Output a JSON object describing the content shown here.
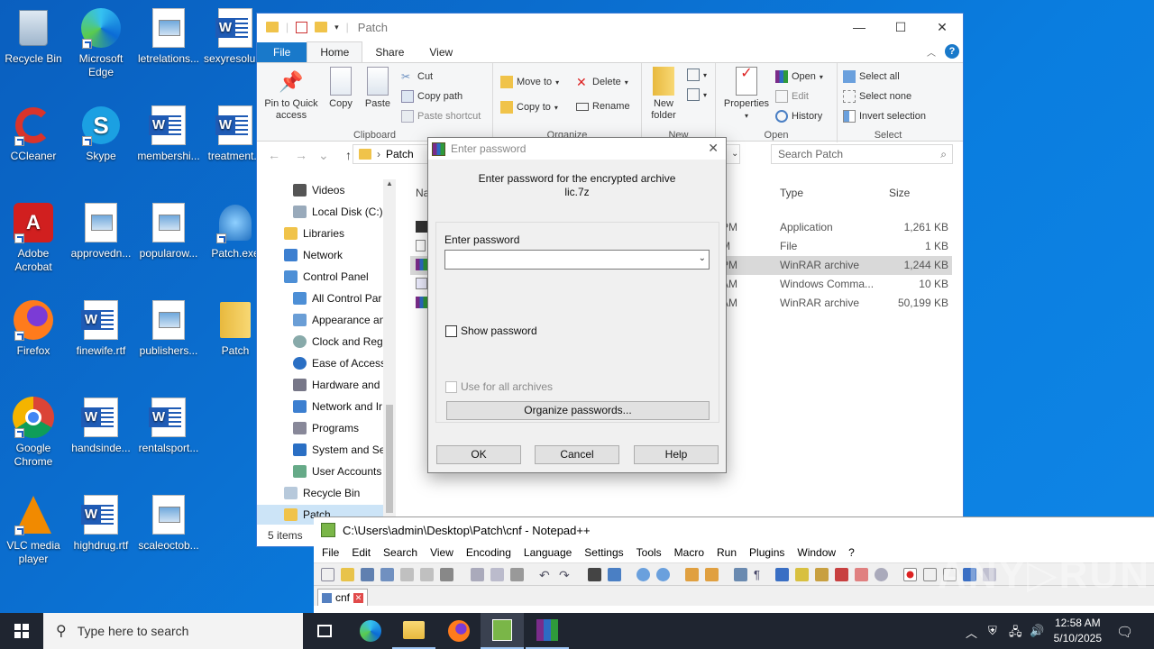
{
  "desktop": {
    "icons": [
      {
        "label": "Recycle Bin"
      },
      {
        "label": "Microsoft Edge"
      },
      {
        "label": "letrelations..."
      },
      {
        "label": "sexyresolut..."
      },
      {
        "label": "CCleaner"
      },
      {
        "label": "Skype"
      },
      {
        "label": "membershi..."
      },
      {
        "label": "treatment..."
      },
      {
        "label": "Adobe Acrobat"
      },
      {
        "label": "approvedn..."
      },
      {
        "label": "popularow..."
      },
      {
        "label": "Patch.exe"
      },
      {
        "label": "Firefox"
      },
      {
        "label": "finewife.rtf"
      },
      {
        "label": "publishers..."
      },
      {
        "label": "Patch"
      },
      {
        "label": "Google Chrome"
      },
      {
        "label": "handsinde..."
      },
      {
        "label": "rentalsport..."
      },
      {
        "label": "VLC media player"
      },
      {
        "label": "highdrug.rtf"
      },
      {
        "label": "scaleoctob..."
      }
    ]
  },
  "explorer": {
    "title": "Patch",
    "tabs": {
      "file": "File",
      "home": "Home",
      "share": "Share",
      "view": "View"
    },
    "ribbon": {
      "clipboard": {
        "group": "Clipboard",
        "pin": "Pin to Quick access",
        "copy": "Copy",
        "paste": "Paste",
        "cut": "Cut",
        "copy_path": "Copy path",
        "paste_shortcut": "Paste shortcut"
      },
      "organize": {
        "group": "Organize",
        "move_to": "Move to",
        "copy_to": "Copy to",
        "delete": "Delete",
        "rename": "Rename"
      },
      "new": {
        "group": "New",
        "new_folder": "New folder"
      },
      "open": {
        "group": "Open",
        "properties": "Properties",
        "open": "Open",
        "edit": "Edit",
        "history": "History"
      },
      "select": {
        "group": "Select",
        "select_all": "Select all",
        "select_none": "Select none",
        "invert": "Invert selection"
      }
    },
    "address": {
      "path": "Patch",
      "search_placeholder": "Search Patch"
    },
    "nav": [
      {
        "label": "Videos"
      },
      {
        "label": "Local Disk (C:)"
      },
      {
        "label": "Libraries"
      },
      {
        "label": "Network"
      },
      {
        "label": "Control Panel"
      },
      {
        "label": "All Control Par"
      },
      {
        "label": "Appearance an"
      },
      {
        "label": "Clock and Regi"
      },
      {
        "label": "Ease of Access"
      },
      {
        "label": "Hardware and"
      },
      {
        "label": "Network and Ir"
      },
      {
        "label": "Programs"
      },
      {
        "label": "System and Se"
      },
      {
        "label": "User Accounts"
      },
      {
        "label": "Recycle Bin"
      },
      {
        "label": "Patch"
      }
    ],
    "columns": {
      "name": "Na",
      "type": "Type",
      "size": "Size"
    },
    "files": [
      {
        "time": "PM",
        "type": "Application",
        "size": "1,261 KB"
      },
      {
        "time": "M",
        "type": "File",
        "size": "1 KB"
      },
      {
        "time": "PM",
        "type": "WinRAR archive",
        "size": "1,244 KB"
      },
      {
        "time": "AM",
        "type": "Windows Comma...",
        "size": "10 KB"
      },
      {
        "time": "AM",
        "type": "WinRAR archive",
        "size": "50,199 KB"
      }
    ],
    "status": "5 items"
  },
  "dialog": {
    "title": "Enter password",
    "message_line1": "Enter password for the encrypted archive",
    "message_line2": "lic.7z",
    "password_label": "Enter password",
    "password_value": "",
    "show_password": "Show password",
    "use_for_all": "Use for all archives",
    "organize": "Organize passwords...",
    "ok": "OK",
    "cancel": "Cancel",
    "help": "Help"
  },
  "notepadpp": {
    "title": "C:\\Users\\admin\\Desktop\\Patch\\cnf - Notepad++",
    "menu": [
      "File",
      "Edit",
      "Search",
      "View",
      "Encoding",
      "Language",
      "Settings",
      "Tools",
      "Macro",
      "Run",
      "Plugins",
      "Window",
      "?"
    ],
    "tab": "cnf"
  },
  "taskbar": {
    "search_placeholder": "Type here to search",
    "time": "12:58 AM",
    "date": "5/10/2025"
  }
}
